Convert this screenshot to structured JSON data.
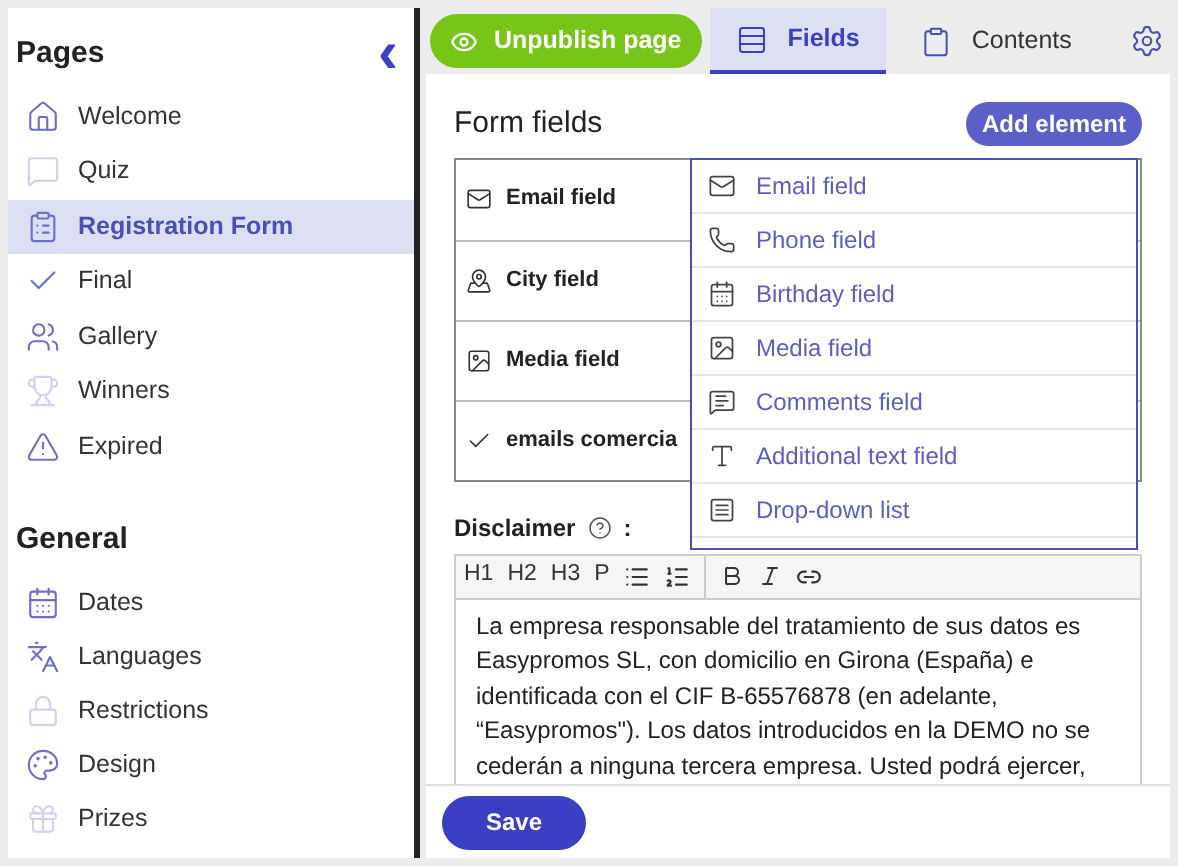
{
  "sidebar": {
    "collapse_icon": "‹",
    "sections": [
      {
        "title": "Pages",
        "items": [
          {
            "label": "Welcome",
            "selected": false
          },
          {
            "label": "Quiz",
            "selected": false
          },
          {
            "label": "Registration Form",
            "selected": true
          },
          {
            "label": "Final",
            "selected": false
          },
          {
            "label": "Gallery",
            "selected": false
          },
          {
            "label": "Winners",
            "selected": false
          },
          {
            "label": "Expired",
            "selected": false
          }
        ]
      },
      {
        "title": "General",
        "items": [
          {
            "label": "Dates",
            "selected": false
          },
          {
            "label": "Languages",
            "selected": false
          },
          {
            "label": "Restrictions",
            "selected": false
          },
          {
            "label": "Design",
            "selected": false
          },
          {
            "label": "Prizes",
            "selected": false
          }
        ]
      }
    ]
  },
  "toolbar": {
    "publish_button": "Unpublish page",
    "tabs": [
      {
        "label": "Fields",
        "selected": true
      },
      {
        "label": "Contents",
        "selected": false
      }
    ]
  },
  "form_fields": {
    "title": "Form fields",
    "add_button": "Add element",
    "fields": [
      {
        "label": "Email field"
      },
      {
        "label": "City field"
      },
      {
        "label": "Media field"
      },
      {
        "label": "emails comercia"
      }
    ]
  },
  "dropdown": {
    "items": [
      {
        "label": "Email field"
      },
      {
        "label": "Phone field"
      },
      {
        "label": "Birthday field"
      },
      {
        "label": "Media field"
      },
      {
        "label": "Comments field"
      },
      {
        "label": "Additional text field"
      },
      {
        "label": "Drop-down list"
      }
    ]
  },
  "disclaimer": {
    "label": "Disclaimer",
    "suffix": ":",
    "editor_buttons": [
      "H1",
      "H2",
      "H3",
      "P"
    ],
    "text": "La empresa responsable del tratamiento de sus datos es Easypromos SL, con domicilio en Girona (España) e identificada con el CIF B-65576878 (en adelante, “Easypromos\"). Los datos introducidos en la DEMO no se cederán a ninguna tercera empresa. Usted podrá ejercer,"
  },
  "save_button": "Save"
}
